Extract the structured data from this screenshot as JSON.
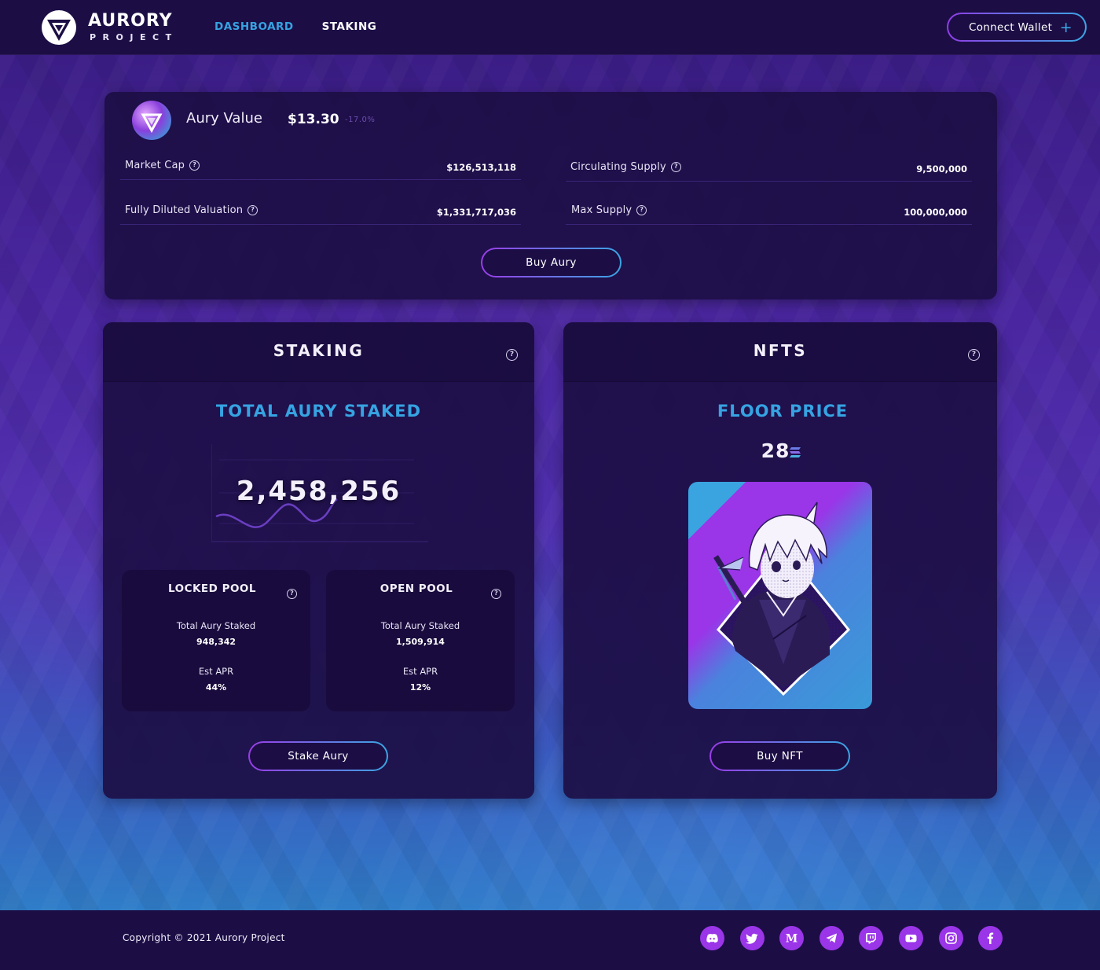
{
  "header": {
    "logo_word": "AURORY",
    "logo_sub": "PROJECT",
    "nav": [
      {
        "label": "DASHBOARD",
        "active": true
      },
      {
        "label": "STAKING",
        "active": false
      }
    ],
    "connect_label": "Connect Wallet",
    "connect_icon": "plus-icon"
  },
  "aury": {
    "label": "Aury Value",
    "price": "$13.30",
    "change": "-17.0%",
    "stats": {
      "market_cap": {
        "label": "Market Cap",
        "value": "$126,513,118"
      },
      "circulating_supply": {
        "label": "Circulating Supply",
        "value": "9,500,000"
      },
      "fdv": {
        "label": "Fully Diluted Valuation",
        "value": "$1,331,717,036"
      },
      "max_supply": {
        "label": "Max Supply",
        "value": "100,000,000"
      }
    },
    "buy_label": "Buy Aury"
  },
  "staking": {
    "title": "STAKING",
    "section_title": "TOTAL AURY STAKED",
    "total": "2,458,256",
    "locked_pool": {
      "title": "LOCKED POOL",
      "staked_label": "Total Aury Staked",
      "staked_value": "948,342",
      "apr_label": "Est APR",
      "apr_value": "44%"
    },
    "open_pool": {
      "title": "OPEN POOL",
      "staked_label": "Total Aury Staked",
      "staked_value": "1,509,914",
      "apr_label": "Est APR",
      "apr_value": "12%"
    },
    "stake_label": "Stake Aury"
  },
  "nfts": {
    "title": "NFTS",
    "section_title": "FLOOR PRICE",
    "floor_value": "28",
    "currency_icon": "solana-icon",
    "buy_label": "Buy NFT"
  },
  "footer": {
    "copyright": "Copyright © 2021 Aurory Project",
    "socials": [
      "discord-icon",
      "twitter-icon",
      "medium-icon",
      "telegram-icon",
      "twitch-icon",
      "youtube-icon",
      "instagram-icon",
      "facebook-icon"
    ]
  },
  "colors": {
    "accent_blue": "#36a3e2",
    "accent_purple": "#9a35e8",
    "panel": "#1c0e45"
  }
}
